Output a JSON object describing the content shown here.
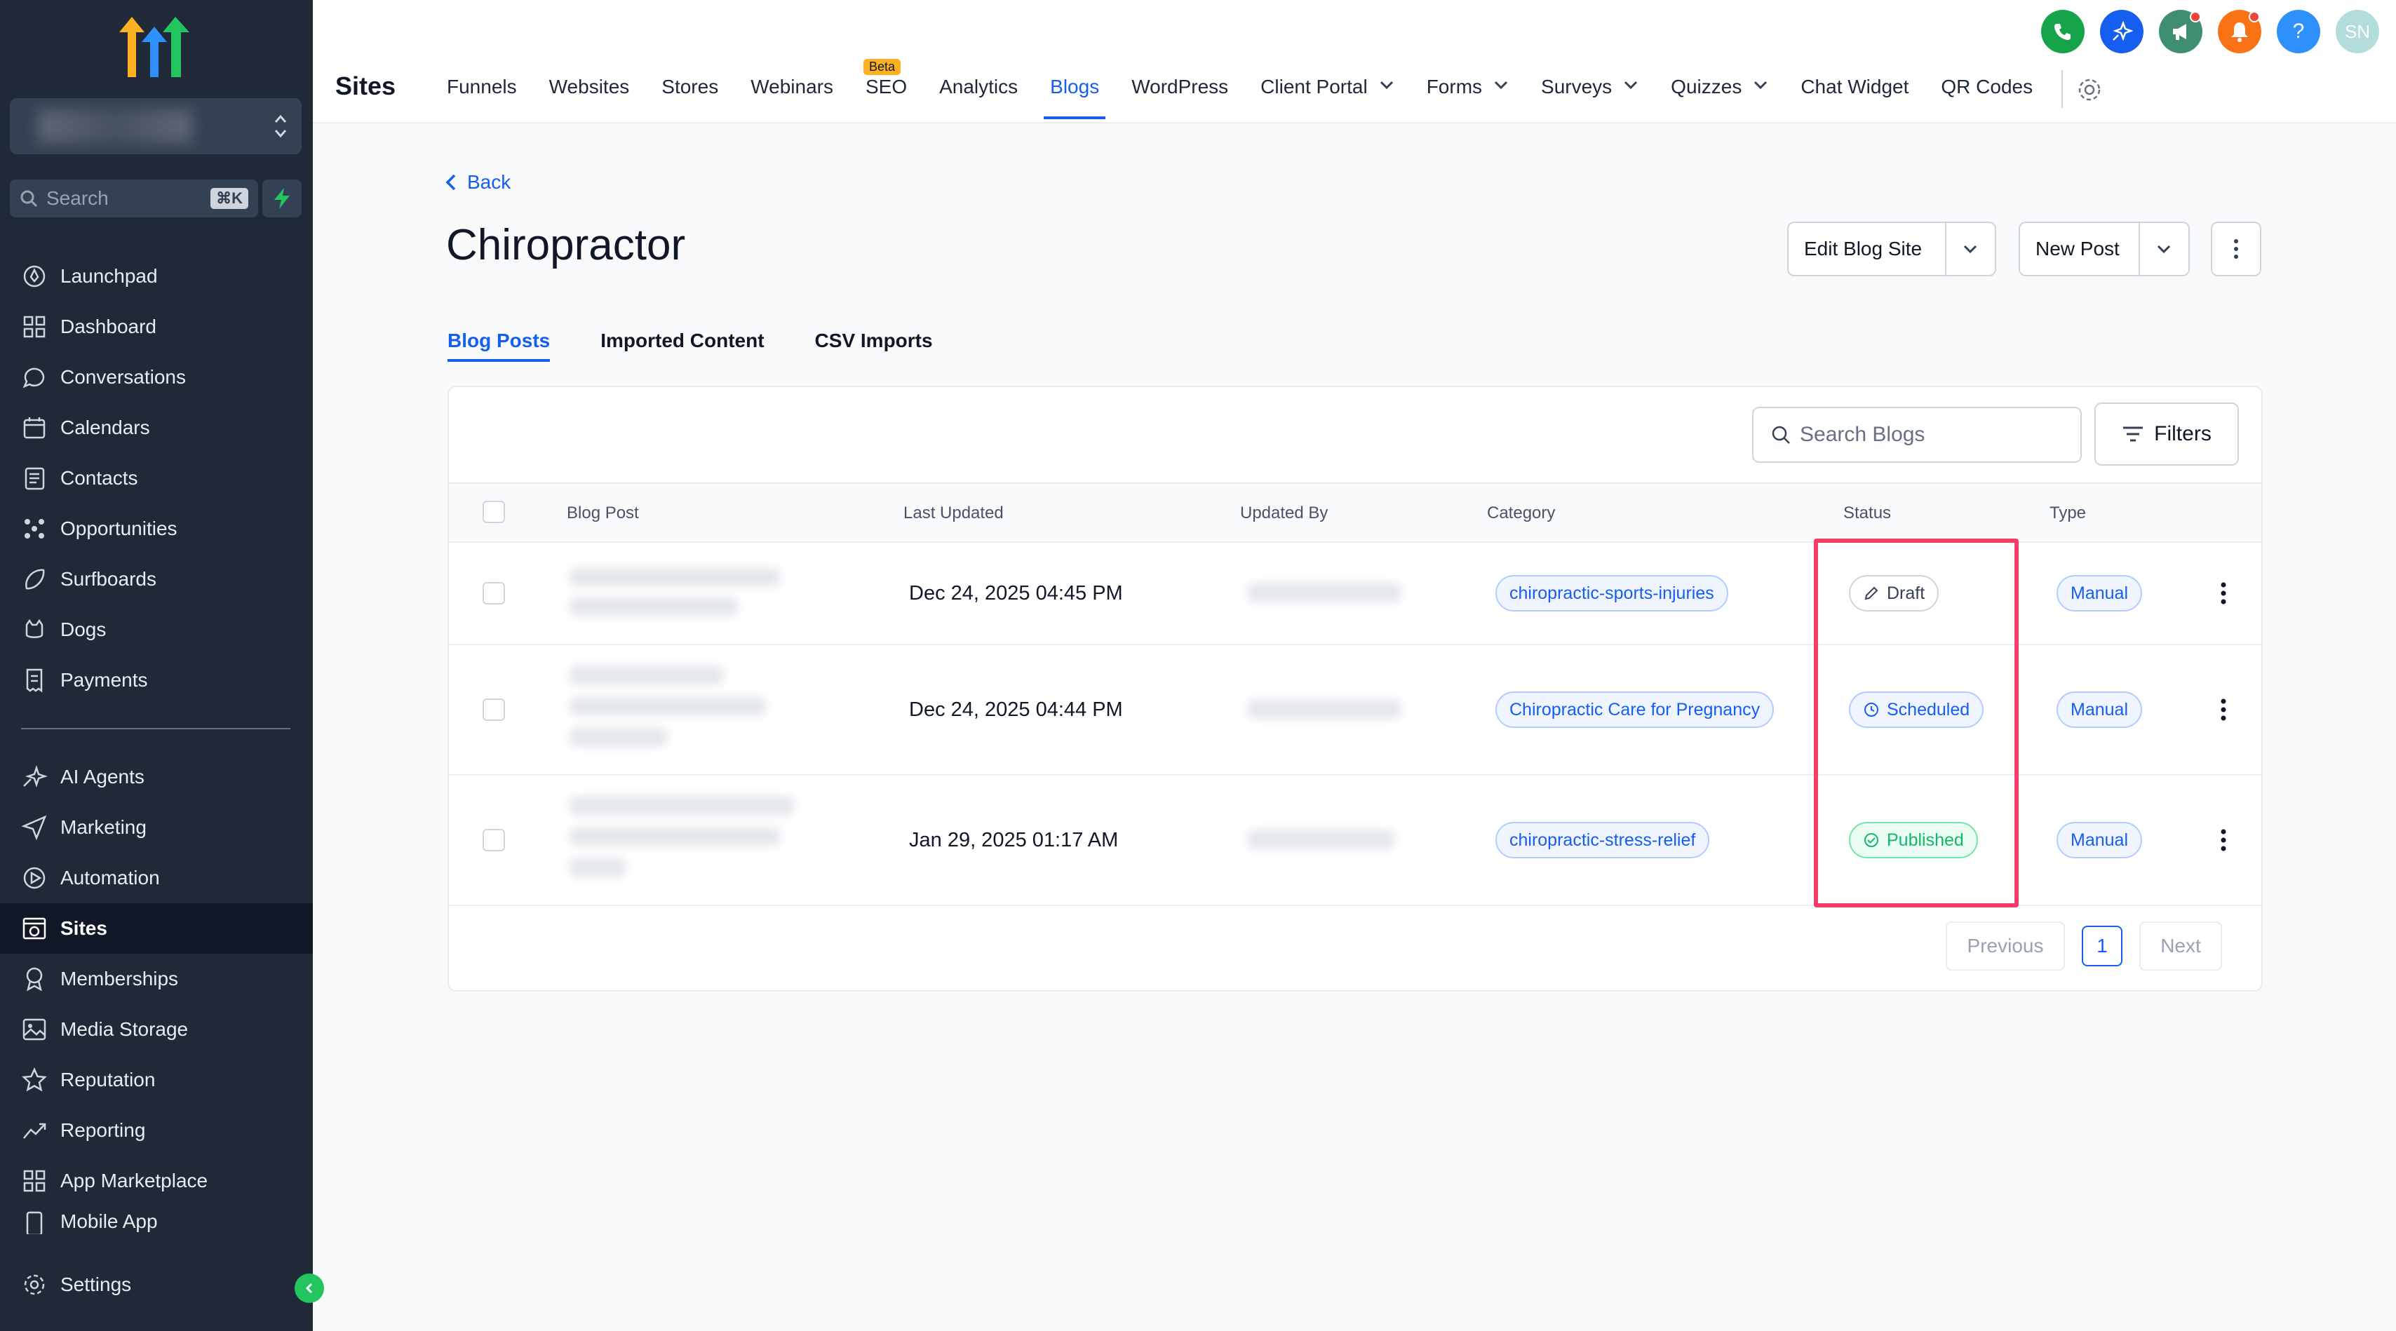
{
  "sidebar": {
    "search_placeholder": "Search",
    "search_shortcut": "⌘K",
    "items": [
      {
        "label": "Launchpad",
        "icon": "rocket-icon"
      },
      {
        "label": "Dashboard",
        "icon": "grid-icon"
      },
      {
        "label": "Conversations",
        "icon": "chat-icon"
      },
      {
        "label": "Calendars",
        "icon": "calendar-icon"
      },
      {
        "label": "Contacts",
        "icon": "contacts-icon"
      },
      {
        "label": "Opportunities",
        "icon": "pipeline-icon"
      },
      {
        "label": "Surfboards",
        "icon": "surfboard-icon"
      },
      {
        "label": "Dogs",
        "icon": "dog-icon"
      },
      {
        "label": "Payments",
        "icon": "receipt-icon"
      }
    ],
    "items2": [
      {
        "label": "AI Agents",
        "icon": "sparkle-icon"
      },
      {
        "label": "Marketing",
        "icon": "send-icon"
      },
      {
        "label": "Automation",
        "icon": "automation-icon"
      },
      {
        "label": "Sites",
        "icon": "sites-icon",
        "active": true
      },
      {
        "label": "Memberships",
        "icon": "award-icon"
      },
      {
        "label": "Media Storage",
        "icon": "image-icon"
      },
      {
        "label": "Reputation",
        "icon": "star-icon"
      },
      {
        "label": "Reporting",
        "icon": "trend-icon"
      },
      {
        "label": "App Marketplace",
        "icon": "apps-icon"
      },
      {
        "label": "Mobile App",
        "icon": "mobile-icon"
      }
    ],
    "settings_label": "Settings"
  },
  "topbar": {
    "page_label": "Sites",
    "nav": [
      {
        "label": "Funnels"
      },
      {
        "label": "Websites"
      },
      {
        "label": "Stores"
      },
      {
        "label": "Webinars"
      },
      {
        "label": "SEO",
        "badge": "Beta"
      },
      {
        "label": "Analytics"
      },
      {
        "label": "Blogs",
        "active": true
      },
      {
        "label": "WordPress"
      },
      {
        "label": "Client Portal",
        "dropdown": true
      },
      {
        "label": "Forms",
        "dropdown": true
      },
      {
        "label": "Surveys",
        "dropdown": true
      },
      {
        "label": "Quizzes",
        "dropdown": true
      },
      {
        "label": "Chat Widget"
      },
      {
        "label": "QR Codes"
      }
    ],
    "avatar_initials": "SN",
    "colors": {
      "phone": "#16a34a",
      "ai": "#155eef",
      "announce": "#3e8e6f",
      "bell": "#f97316",
      "help": "#2e90fa"
    }
  },
  "main": {
    "back_label": "Back",
    "title": "Chiropractor",
    "edit_button": "Edit Blog Site",
    "new_post_button": "New Post",
    "tabs": [
      {
        "label": "Blog Posts",
        "active": true
      },
      {
        "label": "Imported Content"
      },
      {
        "label": "CSV Imports"
      }
    ],
    "search_placeholder": "Search Blogs",
    "filters_label": "Filters",
    "columns": [
      "Blog Post",
      "Last Updated",
      "Updated By",
      "Category",
      "Status",
      "Type"
    ],
    "rows": [
      {
        "last_updated": "Dec 24, 2025 04:45 PM",
        "category": "chiropractic-sports-injuries",
        "status": "Draft",
        "type": "Manual"
      },
      {
        "last_updated": "Dec 24, 2025 04:44 PM",
        "category": "Chiropractic Care for Pregnancy",
        "status": "Scheduled",
        "type": "Manual"
      },
      {
        "last_updated": "Jan 29, 2025 01:17 AM",
        "category": "chiropractic-stress-relief",
        "status": "Published",
        "type": "Manual"
      }
    ],
    "pagination": {
      "previous": "Previous",
      "current": "1",
      "next": "Next"
    }
  }
}
